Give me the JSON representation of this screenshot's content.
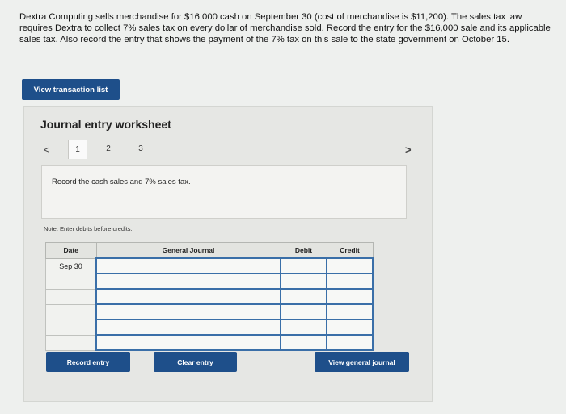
{
  "problem": {
    "text": "Dextra Computing sells merchandise for $16,000 cash on September 30 (cost of merchandise is $11,200). The sales tax law requires Dextra to collect 7% sales tax on every dollar of merchandise sold. Record the entry for the $16,000 sale and its applicable sales tax. Also record the entry that shows the payment of the 7% tax on this sale to the state government on October 15."
  },
  "toolbar": {
    "view_transactions_label": "View transaction list"
  },
  "worksheet": {
    "title": "Journal entry worksheet",
    "nav": {
      "prev": "<",
      "next": ">"
    },
    "tabs": [
      {
        "label": "1",
        "active": true
      },
      {
        "label": "2",
        "active": false
      },
      {
        "label": "3",
        "active": false
      }
    ],
    "instruction": "Record the cash sales and 7% sales tax.",
    "note": "Note: Enter debits before credits.",
    "table": {
      "headers": {
        "date": "Date",
        "general_journal": "General Journal",
        "debit": "Debit",
        "credit": "Credit"
      },
      "rows": [
        {
          "date": "Sep 30"
        },
        {
          "date": ""
        },
        {
          "date": ""
        },
        {
          "date": ""
        },
        {
          "date": ""
        },
        {
          "date": ""
        }
      ]
    },
    "buttons": {
      "record": "Record entry",
      "clear": "Clear entry",
      "view_general": "View general journal"
    }
  },
  "colors": {
    "primary_button": "#1e4f8a",
    "field_border": "#3a6fa8"
  }
}
